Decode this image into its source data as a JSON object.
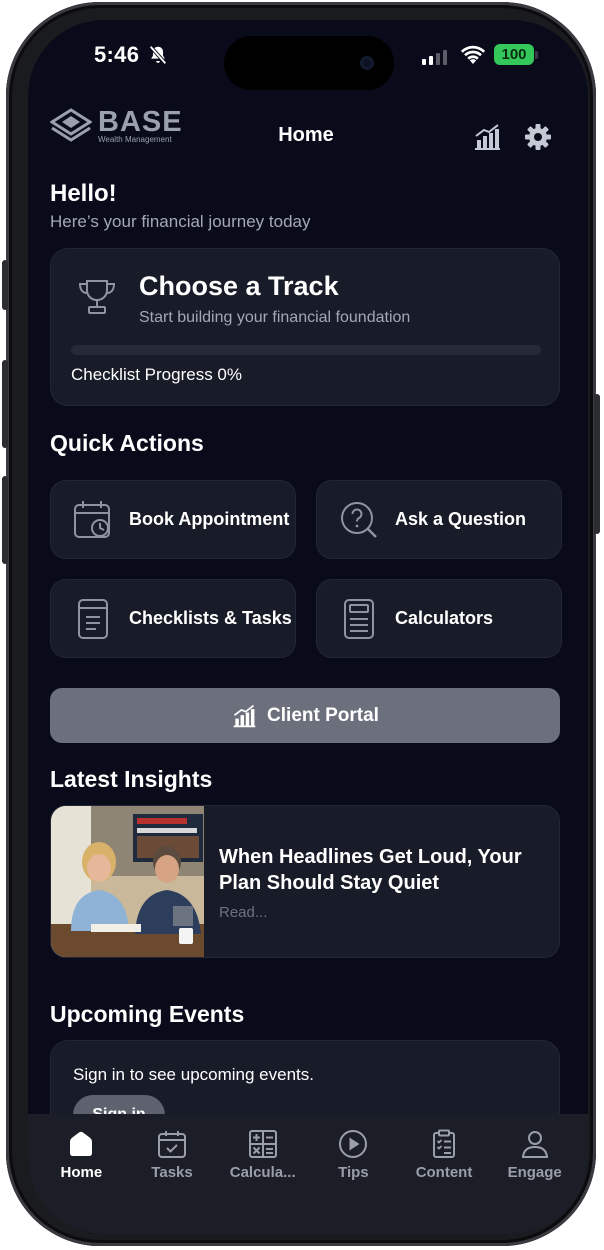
{
  "status_bar": {
    "time": "5:46",
    "battery": "100"
  },
  "header": {
    "logo_main": "BASE",
    "logo_sub": "Wealth Management",
    "title": "Home"
  },
  "greeting": {
    "title": "Hello!",
    "subtitle": "Here’s your financial journey today"
  },
  "track_card": {
    "title": "Choose a Track",
    "subtitle": "Start building your financial foundation",
    "progress_label": "Checklist Progress 0%",
    "progress_fraction": 0
  },
  "quick_actions": {
    "title": "Quick Actions",
    "items": [
      {
        "label": "Book Appointment",
        "icon": "calendar-icon"
      },
      {
        "label": "Ask a Question",
        "icon": "question-icon"
      },
      {
        "label": "Checklists & Tasks",
        "icon": "checklist-icon"
      },
      {
        "label": "Calculators",
        "icon": "calculator-icon"
      }
    ]
  },
  "client_portal": {
    "label": "Client Portal",
    "icon": "chart-icon"
  },
  "insights": {
    "title": "Latest Insights",
    "items": [
      {
        "title": "When Headlines Get Loud, Your Plan Should Stay Quiet",
        "read": "Read...",
        "image": "couple-watching-news-photo"
      }
    ]
  },
  "events": {
    "title": "Upcoming Events",
    "message": "Sign in to see upcoming events.",
    "button": "Sign in"
  },
  "tabs": [
    {
      "label": "Home",
      "icon": "home-icon",
      "active": true
    },
    {
      "label": "Tasks",
      "icon": "tasks-icon",
      "active": false
    },
    {
      "label": "Calcula...",
      "icon": "calculator-icon",
      "active": false
    },
    {
      "label": "Tips",
      "icon": "play-icon",
      "active": false
    },
    {
      "label": "Content",
      "icon": "clipboard-icon",
      "active": false
    },
    {
      "label": "Engage",
      "icon": "person-icon",
      "active": false
    }
  ],
  "colors": {
    "background": "#090b1a",
    "card": "#181b28",
    "battery": "#34c759",
    "portal_button": "#6c707c"
  }
}
